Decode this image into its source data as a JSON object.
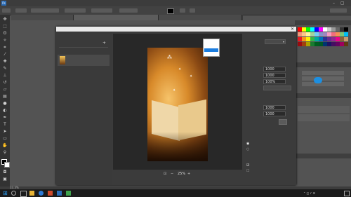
{
  "menu": [
    "",
    "",
    "",
    "",
    "",
    "",
    "",
    "",
    "",
    ""
  ],
  "doc_tabs": [
    {
      "label": "",
      "active": false
    },
    {
      "label": "",
      "active": true
    },
    {
      "label": "",
      "active": false
    }
  ],
  "dialog": {
    "title": "",
    "left_header": "",
    "col_labels": [
      "",
      ""
    ],
    "file_item": {
      "name": "",
      "size": ""
    },
    "right": {
      "section1": "",
      "format_label": "",
      "format_value": "",
      "format_options": [
        "",
        "",
        "",
        ""
      ],
      "image_size_header": "",
      "width_label": "",
      "width_value": "1000",
      "height_label": "",
      "height_value": "1000",
      "percent_label": "",
      "percent_value": "100%",
      "resample_label": "",
      "resample_value": "",
      "canvas_size_header": "",
      "canvas_width_label": "",
      "canvas_width_value": "1000",
      "canvas_height_label": "",
      "canvas_height_value": "1000",
      "metadata_header": "",
      "metadata_value": "",
      "color_space_header": "",
      "color_space_value": "",
      "export_button": "",
      "cancel_button": ""
    },
    "zoom": "25%",
    "footer_left": ""
  },
  "statusbar": {
    "zoom": "33.3%",
    "doc": ""
  },
  "colors": {
    "dlg_bg": "#3b3b3b",
    "accent": "#1c7ee0",
    "taskbar": "#1b1b1b"
  },
  "icons": [
    "move-icon",
    "marquee-icon",
    "lasso-icon",
    "wand-icon",
    "crop-icon",
    "eyedropper-icon",
    "heal-icon",
    "brush-icon",
    "stamp-icon",
    "history-brush-icon",
    "eraser-icon",
    "gradient-icon",
    "blur-icon",
    "dodge-icon",
    "pen-icon",
    "type-icon",
    "path-select-icon",
    "shape-icon",
    "hand-icon",
    "zoom-icon"
  ]
}
